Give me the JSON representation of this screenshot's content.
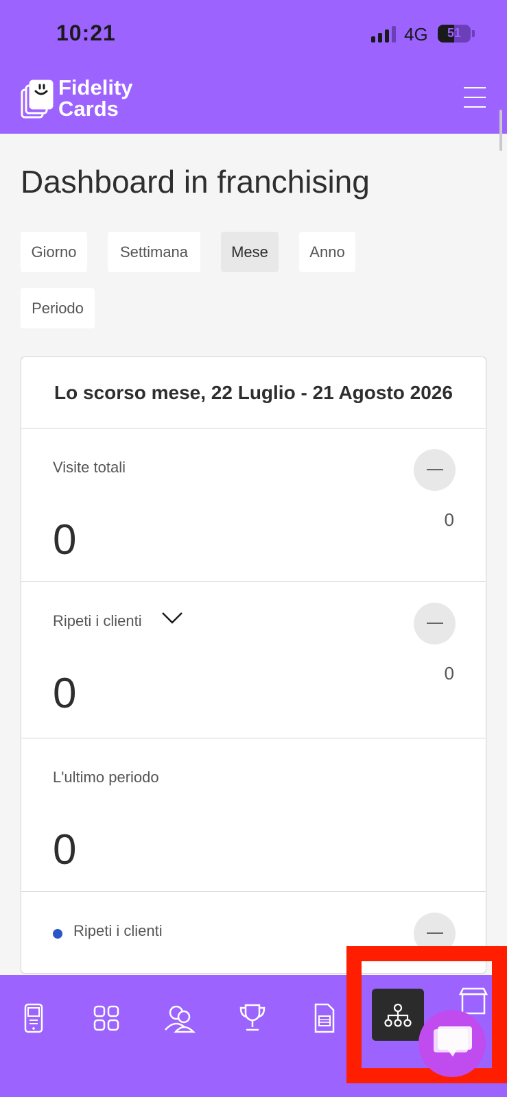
{
  "status_bar": {
    "time": "10:21",
    "network": "4G",
    "battery": "51"
  },
  "header": {
    "logo_line1": "Fidelity",
    "logo_line2": "Cards"
  },
  "page": {
    "title": "Dashboard in franchising"
  },
  "filters": [
    {
      "label": "Giorno",
      "active": false
    },
    {
      "label": "Settimana",
      "active": false
    },
    {
      "label": "Mese",
      "active": true
    },
    {
      "label": "Anno",
      "active": false
    },
    {
      "label": "Periodo",
      "active": false
    }
  ],
  "stats": {
    "heading": "Lo scorso mese, 22 Luglio - 21 Agosto 2026",
    "rows": [
      {
        "label": "Visite totali",
        "value": "0",
        "secondary": "0"
      },
      {
        "label": "Ripeti i clienti",
        "value": "0",
        "secondary": "0"
      },
      {
        "label": "L'ultimo periodo",
        "value": "0"
      },
      {
        "label": "Ripeti i clienti"
      }
    ]
  },
  "bottom_nav": {
    "items": [
      {
        "icon": "phone-card-icon"
      },
      {
        "icon": "grid-icon"
      },
      {
        "icon": "users-icon"
      },
      {
        "icon": "trophy-icon"
      },
      {
        "icon": "document-icon"
      },
      {
        "icon": "hierarchy-icon",
        "active": true
      },
      {
        "icon": "store-icon"
      }
    ]
  },
  "colors": {
    "brand": "#9c63ff",
    "highlight": "#ff1f00",
    "chat": "#c04cf0",
    "series_dot": "#2a56c6"
  }
}
